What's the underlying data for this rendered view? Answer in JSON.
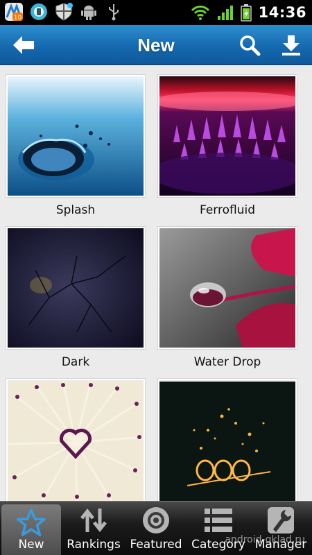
{
  "status_bar": {
    "notification_count": "10",
    "time": "14:36",
    "icons": [
      "app-update-icon",
      "browser-icon",
      "shield-icon",
      "android-icon",
      "usb-icon",
      "wifi-icon",
      "signal-icon",
      "battery-icon"
    ]
  },
  "header": {
    "title": "New",
    "back_icon": "back-arrow-icon",
    "search_icon": "search-icon",
    "download_icon": "download-icon"
  },
  "wallpapers": [
    {
      "title": "Splash"
    },
    {
      "title": "Ferrofluid"
    },
    {
      "title": "Dark"
    },
    {
      "title": "Water Drop"
    },
    {
      "title": ""
    },
    {
      "title": ""
    }
  ],
  "bottom_nav": [
    {
      "label": "New",
      "icon": "star-icon",
      "active": true
    },
    {
      "label": "Rankings",
      "icon": "rankings-icon",
      "active": false
    },
    {
      "label": "Featured",
      "icon": "featured-icon",
      "active": false
    },
    {
      "label": "Category",
      "icon": "list-icon",
      "active": false
    },
    {
      "label": "Manager",
      "icon": "wrench-icon",
      "active": false
    }
  ],
  "watermark": "android-gklad.ru",
  "colors": {
    "header": "#1466ad",
    "background": "#ebebeb",
    "nav_bar": "#1c1c1c",
    "active_icon": "#3a9be0"
  }
}
